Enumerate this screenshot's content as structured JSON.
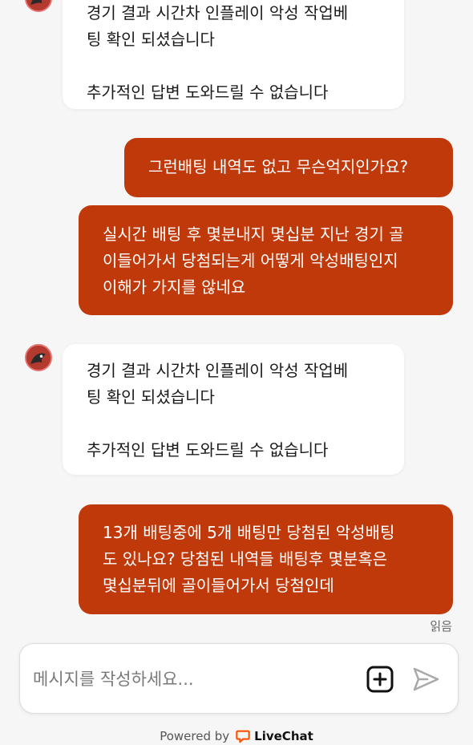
{
  "messages": [
    {
      "from": "agent",
      "text": "경기 결과 시간차 인플레이 악성 작업베\n팅 확인 되셨습니다\n\n추가적인 답변 도와드릴 수 없습니다"
    },
    {
      "from": "user",
      "text": "그런배팅 내역도 없고 무슨억지인가요?"
    },
    {
      "from": "user",
      "text": "실시간 배팅 후 몇분내지 몇십분 지난 경기 골\n이들어가서 당첨되는게 어떻게 악성배팅인지\n이해가 가지를 않네요"
    },
    {
      "from": "agent",
      "text": "경기 결과 시간차 인플레이 악성 작업베\n팅 확인 되셨습니다\n\n추가적인 답변 도와드릴 수 없습니다"
    },
    {
      "from": "user",
      "text": "13개 배팅중에 5개 배팅만 당첨된 악성배팅\n도 있나요? 당첨된 내역들 배팅후 몇분혹은\n몇십분뒤에 골이들어가서 당첨인데"
    }
  ],
  "read_receipt": "읽음",
  "composer": {
    "placeholder": "메시지를 작성하세요..."
  },
  "icons": {
    "attach": "add-square-icon",
    "send": "send-icon",
    "avatar": "agent-avatar"
  },
  "footer": {
    "powered_by": "Powered by",
    "brand": "LiveChat"
  },
  "colors": {
    "user_bubble": "#c0390b",
    "agent_bubble": "#ffffff",
    "background": "#f6f6f6",
    "brand": "#ff5100"
  }
}
